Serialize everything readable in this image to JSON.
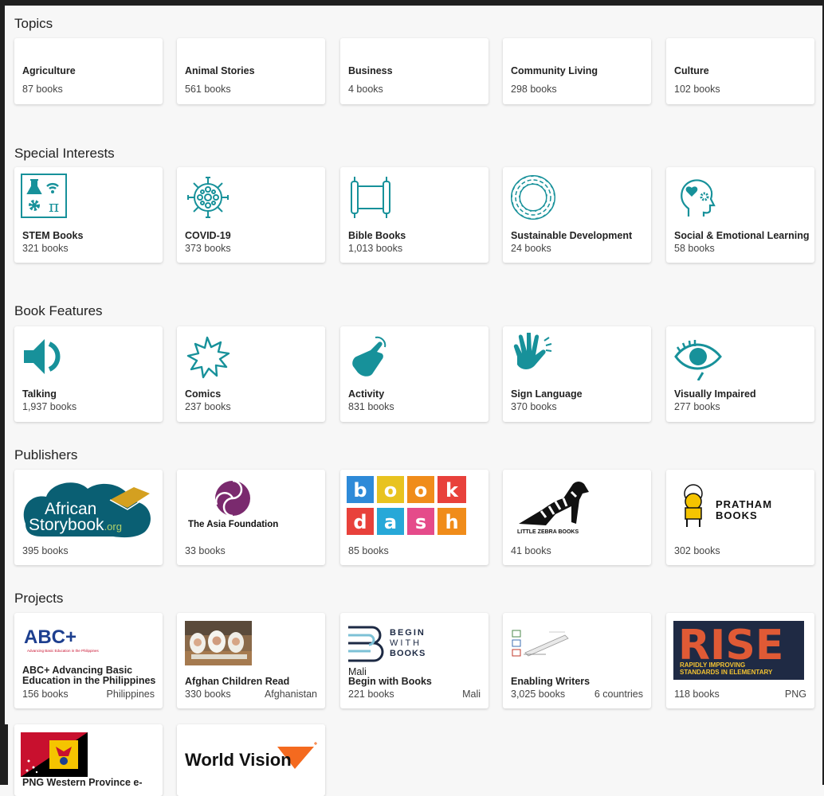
{
  "sections": {
    "topics": "Topics",
    "special": "Special Interests",
    "features": "Book Features",
    "publishers": "Publishers",
    "projects": "Projects"
  },
  "topics": [
    {
      "name": "Agriculture",
      "count": "87 books"
    },
    {
      "name": "Animal Stories",
      "count": "561 books"
    },
    {
      "name": "Business",
      "count": "4 books"
    },
    {
      "name": "Community Living",
      "count": "298 books"
    },
    {
      "name": "Culture",
      "count": "102 books"
    }
  ],
  "special": [
    {
      "name": "STEM Books",
      "count": "321 books",
      "icon": "stem-icon"
    },
    {
      "name": "COVID-19",
      "count": "373 books",
      "icon": "virus-icon"
    },
    {
      "name": "Bible Books",
      "count": "1,013 books",
      "icon": "scroll-icon"
    },
    {
      "name": "Sustainable Development",
      "count": "24 books",
      "icon": "sdg-wheel-icon"
    },
    {
      "name": "Social & Emotional Learning",
      "count": "58 books",
      "icon": "head-heart-icon"
    }
  ],
  "features": [
    {
      "name": "Talking",
      "count": "1,937 books",
      "icon": "speaker-icon"
    },
    {
      "name": "Comics",
      "count": "237 books",
      "icon": "burst-icon"
    },
    {
      "name": "Activity",
      "count": "831 books",
      "icon": "pointing-hand-icon"
    },
    {
      "name": "Sign Language",
      "count": "370 books",
      "icon": "sign-hand-icon"
    },
    {
      "name": "Visually Impaired",
      "count": "277 books",
      "icon": "eye-icon"
    }
  ],
  "publishers": [
    {
      "count": "395 books",
      "logo_text": [
        "African",
        "Storybook",
        ".org"
      ]
    },
    {
      "count": "33 books",
      "logo_text": "The Asia Foundation"
    },
    {
      "count": "85 books",
      "logo_letters": [
        "b",
        "o",
        "o",
        "k",
        "d",
        "a",
        "s",
        "h"
      ]
    },
    {
      "count": "41 books",
      "logo_text": "LITTLE ZEBRA BOOKS"
    },
    {
      "count": "302 books",
      "logo_text": [
        "PRATHAM",
        "BOOKS"
      ]
    }
  ],
  "projects": [
    {
      "name_lines": [
        "ABC+ Advancing Basic",
        "Education in the Philippines"
      ],
      "count": "156 books",
      "country": "Philippines",
      "logo_text": "ABC+",
      "logo_sub": "Advancing Basic Education in the Philippines"
    },
    {
      "name": "Afghan Children Read",
      "count": "330 books",
      "country": "Afghanistan"
    },
    {
      "pre": "Mali",
      "name": "Begin with Books",
      "count": "221 books",
      "country": "Mali",
      "logo_text": [
        "BEGIN",
        "WITH",
        "BOOKS"
      ]
    },
    {
      "name": "Enabling Writers",
      "count": "3,025 books",
      "country": "6 countries"
    },
    {
      "count": "118 books",
      "country": "PNG",
      "logo_text": "RISE",
      "logo_sub": [
        "RAPIDLY IMPROVING",
        "STANDARDS IN ELEMENTARY"
      ]
    },
    {
      "name": "PNG Western Province e-"
    },
    {
      "logo_text": "World Vision"
    }
  ],
  "colors": {
    "teal": "#17919a",
    "brand_blue": "#0a5f73"
  }
}
